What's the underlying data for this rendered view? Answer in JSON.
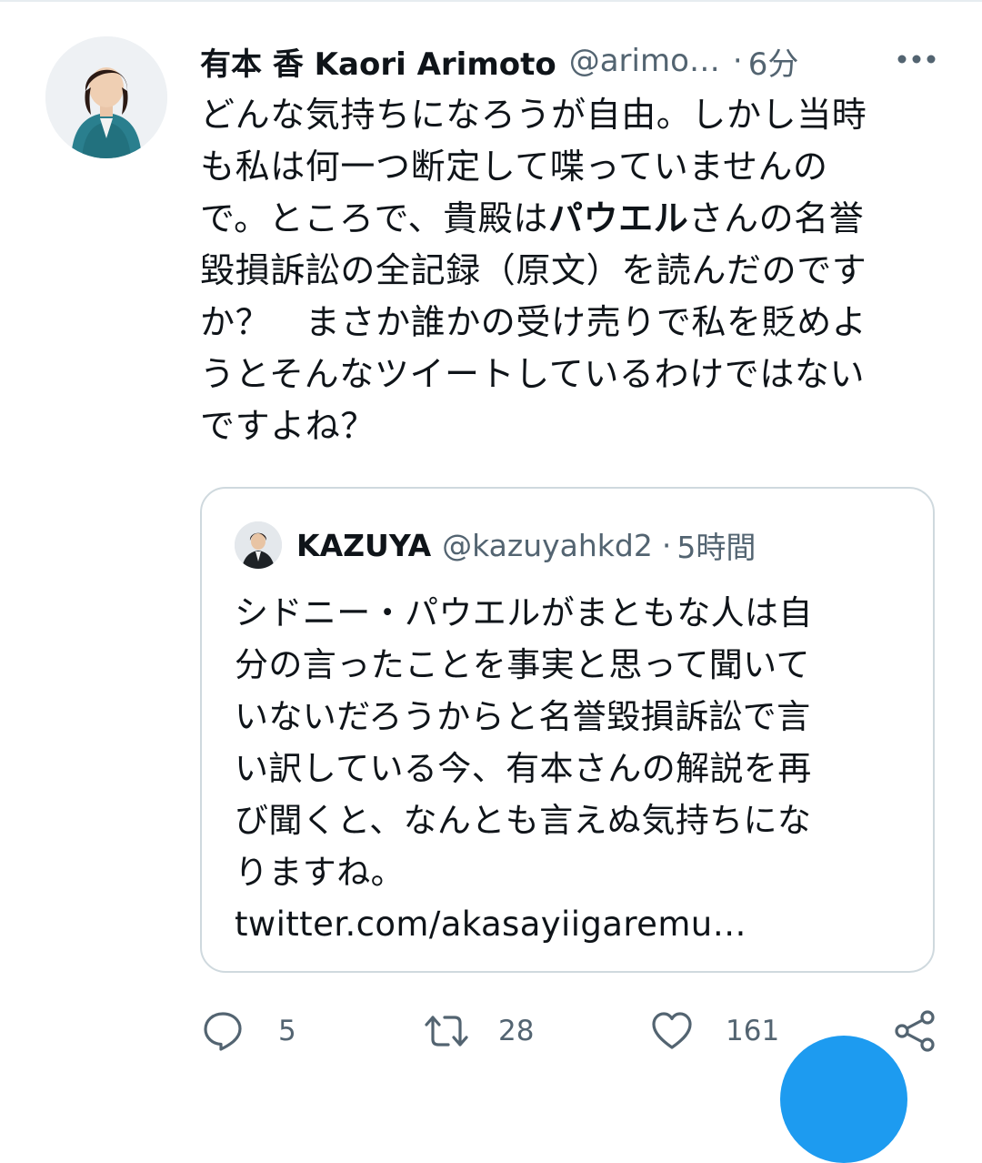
{
  "tweet": {
    "author_name": "有本 香 Kaori Arimoto",
    "handle": "@arimo…",
    "separator": "·",
    "time": "6分",
    "text_lines": [
      "どんな気持ちになろうが自由。しかし当時",
      "も私は何一つ断定して喋っていませんの",
      [
        "で。ところで、貴殿は",
        "パウエル",
        "さんの名誉"
      ],
      "毀損訴訟の全記録（原文）を読んだのです",
      "か？　まさか誰かの受け売りで私を貶めよ",
      "うとそんなツイートしているわけではない",
      "ですよね？"
    ]
  },
  "quote": {
    "author_name": "KAZUYA",
    "handle": "@kazuyahkd2",
    "separator": "·",
    "time": "5時間",
    "text_lines": [
      "シドニー・パウエルがまともな人は自",
      "分の言ったことを事実と思って聞いて",
      "いないだろうからと名誉毀損訴訟で言",
      "い訳している今、有本さんの解説を再",
      "び聞くと、なんとも言えぬ気持ちにな",
      "りますね。"
    ],
    "link": "twitter.com/akasayiigaremu…"
  },
  "actions": {
    "reply_count": "5",
    "retweet_count": "28",
    "like_count": "161"
  },
  "colors": {
    "text": "#0f1419",
    "secondary": "#536471",
    "border": "#cfd9de",
    "accent": "#1d9bf0"
  },
  "icons": [
    "more-icon",
    "reply-icon",
    "retweet-icon",
    "like-icon",
    "share-icon"
  ]
}
